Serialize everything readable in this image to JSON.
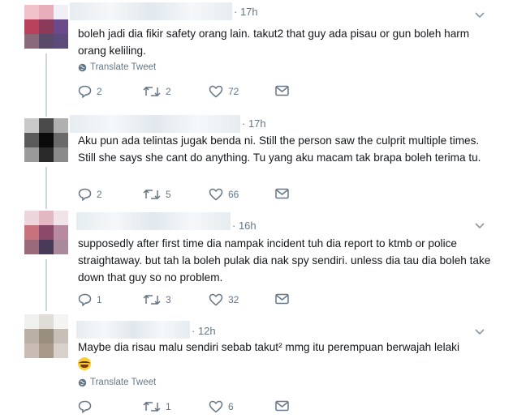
{
  "tweets": [
    {
      "time": "· 17h",
      "text": "boleh jadi dia fikir safety orang lain. takut2 that guy ada pisau or gun boleh harm orang keliling.",
      "translate": "Translate Tweet",
      "replies": "2",
      "retweets": "2",
      "likes": "72",
      "avatar_colors": [
        "#f2c2cb",
        "#e8aebb",
        "#f0f0f6",
        "#b8415c",
        "#8c3a5a",
        "#6a4a8a",
        "#8a6a7a",
        "#5a4a6a",
        "#5c4a7a"
      ]
    },
    {
      "time": "· 17h",
      "text": "Aku pun ada telintas jugak benda ni. Still the person saw the culprit multiple times. Still she says she cant do anything. Tu yang aku macam tak brapa boleh terima tu.",
      "replies": "2",
      "retweets": "5",
      "likes": "66",
      "avatar_colors": [
        "#c8c8c8",
        "#4a4a4a",
        "#b0b0b0",
        "#5a5a5a",
        "#0a0a0a",
        "#6a6a6a",
        "#9a9a9a",
        "#2a2a2a",
        "#8a8a8a"
      ]
    },
    {
      "time": "· 16h",
      "text": "supposedly after first time dia nampak incident tuh dia report to ktmb or police straightaway. but tah la boleh pulak dia nak spy sendiri. unless dia tau dia boleh take down that guy so no problem.",
      "replies": "1",
      "retweets": "3",
      "likes": "32",
      "avatar_colors": [
        "#ecd6dc",
        "#e2b8c2",
        "#f0e4ea",
        "#c8727e",
        "#8c4a6a",
        "#b88aa0",
        "#9a6a7a",
        "#4a3a5a",
        "#aa8a9a"
      ]
    },
    {
      "time": "· 12h",
      "text": "Maybe dia risau malu sendiri sebab takut² mmg itu perempuan berwajah lelaki",
      "translate": "Translate Tweet",
      "replies": "",
      "retweets": "1",
      "likes": "6",
      "avatar_colors": [
        "#f0f0ee",
        "#e0ddd8",
        "#f4f4f2",
        "#bab0a6",
        "#9a8e7e",
        "#c8c0b8",
        "#c8bcb4",
        "#a8988a",
        "#d8d0ca"
      ]
    }
  ]
}
